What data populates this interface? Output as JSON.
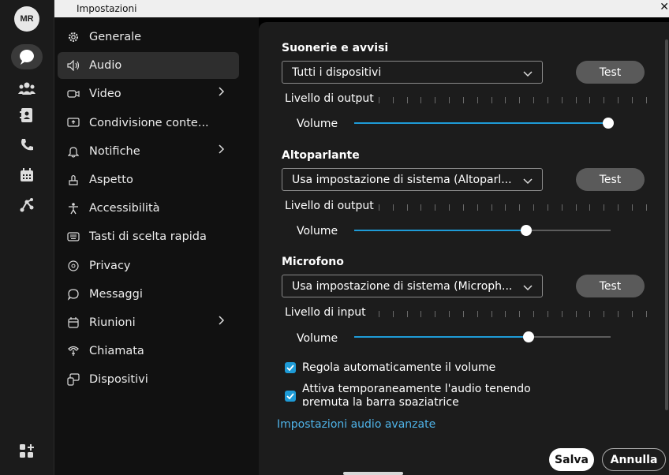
{
  "rail": {
    "avatar_initials": "MR",
    "icons": [
      "chat-icon",
      "team-icon",
      "contacts-icon",
      "calls-icon",
      "calendar-icon",
      "workflow-icon",
      "apps-icon"
    ]
  },
  "window": {
    "title": "Impostazioni",
    "close": "✕"
  },
  "nav": {
    "items": [
      {
        "label": "Generale",
        "icon": "gear-icon",
        "has_submenu": false,
        "active": false
      },
      {
        "label": "Audio",
        "icon": "speaker-icon",
        "has_submenu": false,
        "active": true
      },
      {
        "label": "Video",
        "icon": "video-icon",
        "has_submenu": true,
        "active": false
      },
      {
        "label": "Condivisione conte...",
        "icon": "share-screen-icon",
        "has_submenu": false,
        "active": false
      },
      {
        "label": "Notifiche",
        "icon": "bell-icon",
        "has_submenu": true,
        "active": false
      },
      {
        "label": "Aspetto",
        "icon": "appearance-icon",
        "has_submenu": false,
        "active": false
      },
      {
        "label": "Accessibilità",
        "icon": "accessibility-icon",
        "has_submenu": false,
        "active": false
      },
      {
        "label": "Tasti di scelta rapida",
        "icon": "keyboard-icon",
        "has_submenu": false,
        "active": false
      },
      {
        "label": "Privacy",
        "icon": "privacy-icon",
        "has_submenu": false,
        "active": false
      },
      {
        "label": "Messaggi",
        "icon": "message-icon",
        "has_submenu": false,
        "active": false
      },
      {
        "label": "Riunioni",
        "icon": "meeting-icon",
        "has_submenu": true,
        "active": false
      },
      {
        "label": "Chiamata",
        "icon": "phone-icon",
        "has_submenu": false,
        "active": false
      },
      {
        "label": "Dispositivi",
        "icon": "devices-icon",
        "has_submenu": false,
        "active": false
      }
    ]
  },
  "ringtones": {
    "title": "Suonerie e avvisi",
    "device": "Tutti i dispositivi",
    "test_label": "Test",
    "level_label": "Livello di output",
    "volume_label": "Volume",
    "volume": 0.99
  },
  "speaker": {
    "title": "Altoparlante",
    "device": "Usa impostazione di sistema (Altoparl...",
    "test_label": "Test",
    "level_label": "Livello di output",
    "volume_label": "Volume",
    "volume": 0.67
  },
  "microphone": {
    "title": "Microfono",
    "device": "Usa impostazione di sistema (Microph...",
    "test_label": "Test",
    "level_label": "Livello di input",
    "volume_label": "Volume",
    "volume": 0.68
  },
  "options": {
    "auto_volume": {
      "label": "Regola automaticamente il volume",
      "checked": true
    },
    "push_to_talk": {
      "label": "Attiva temporaneamente l'audio tenendo premuta la barra spaziatrice",
      "checked": true
    }
  },
  "advanced_link": "Impostazioni audio avanzate",
  "footer": {
    "save": "Salva",
    "cancel": "Annulla"
  },
  "colors": {
    "accent": "#1e9bd7",
    "panel": "#1c1c1c",
    "nav": "#111111"
  }
}
